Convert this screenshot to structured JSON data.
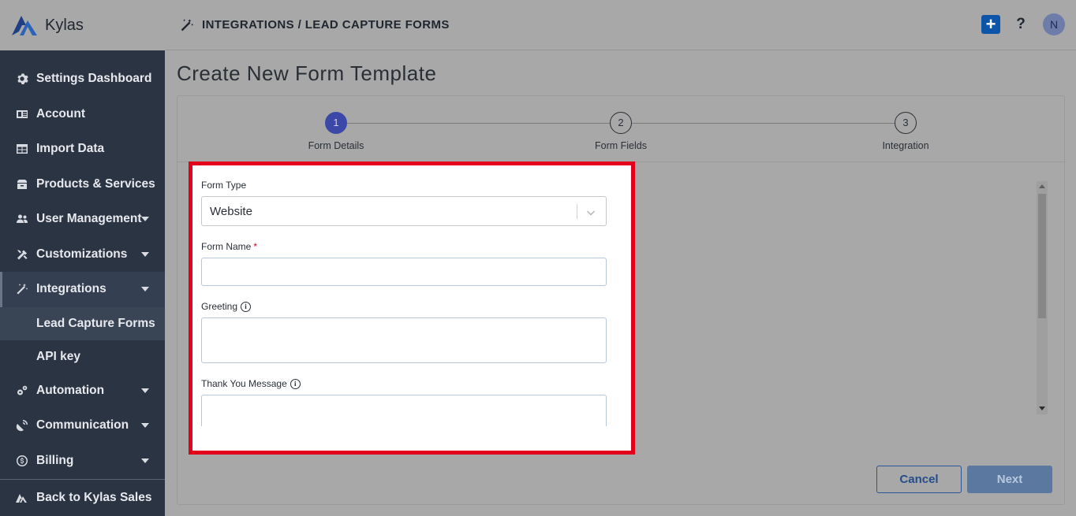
{
  "brand": {
    "name": "Kylas"
  },
  "header": {
    "breadcrumb": "INTEGRATIONS / LEAD CAPTURE FORMS",
    "help_label": "?",
    "avatar_initial": "N",
    "add_label": "+"
  },
  "sidebar": {
    "items": [
      {
        "label": "Settings Dashboard",
        "icon": "gear-icon",
        "caret": false
      },
      {
        "label": "Account",
        "icon": "id-card-icon",
        "caret": false
      },
      {
        "label": "Import Data",
        "icon": "table-icon",
        "caret": false
      },
      {
        "label": "Products & Services",
        "icon": "box-icon",
        "caret": false
      },
      {
        "label": "User Management",
        "icon": "users-icon",
        "caret": true
      },
      {
        "label": "Customizations",
        "icon": "tools-icon",
        "caret": true
      },
      {
        "label": "Integrations",
        "icon": "magic-wand-icon",
        "caret": true,
        "active": true
      }
    ],
    "sub_items": [
      {
        "label": "Lead Capture Forms",
        "active": true
      },
      {
        "label": "API key"
      }
    ],
    "items_after": [
      {
        "label": "Automation",
        "icon": "cogs-icon",
        "caret": true
      },
      {
        "label": "Communication",
        "icon": "satellite-dish-icon",
        "caret": true
      },
      {
        "label": "Billing",
        "icon": "dollar-circle-icon",
        "caret": true
      }
    ],
    "back_label": "Back to Kylas Sales"
  },
  "page": {
    "title": "Create New Form Template"
  },
  "steps": [
    {
      "number": "1",
      "label": "Form Details",
      "current": true
    },
    {
      "number": "2",
      "label": "Form Fields"
    },
    {
      "number": "3",
      "label": "Integration"
    }
  ],
  "form": {
    "form_type_label": "Form Type",
    "form_type_value": "Website",
    "form_name_label": "Form Name",
    "required_mark": "*",
    "greeting_label": "Greeting",
    "thank_you_label": "Thank You Message",
    "info_glyph": "i"
  },
  "actions": {
    "cancel": "Cancel",
    "next": "Next"
  },
  "colors": {
    "highlight": "#e3001b",
    "primary": "#0c55a8",
    "step_active": "#3c48a8",
    "sidebar_bg": "#2b3442"
  }
}
